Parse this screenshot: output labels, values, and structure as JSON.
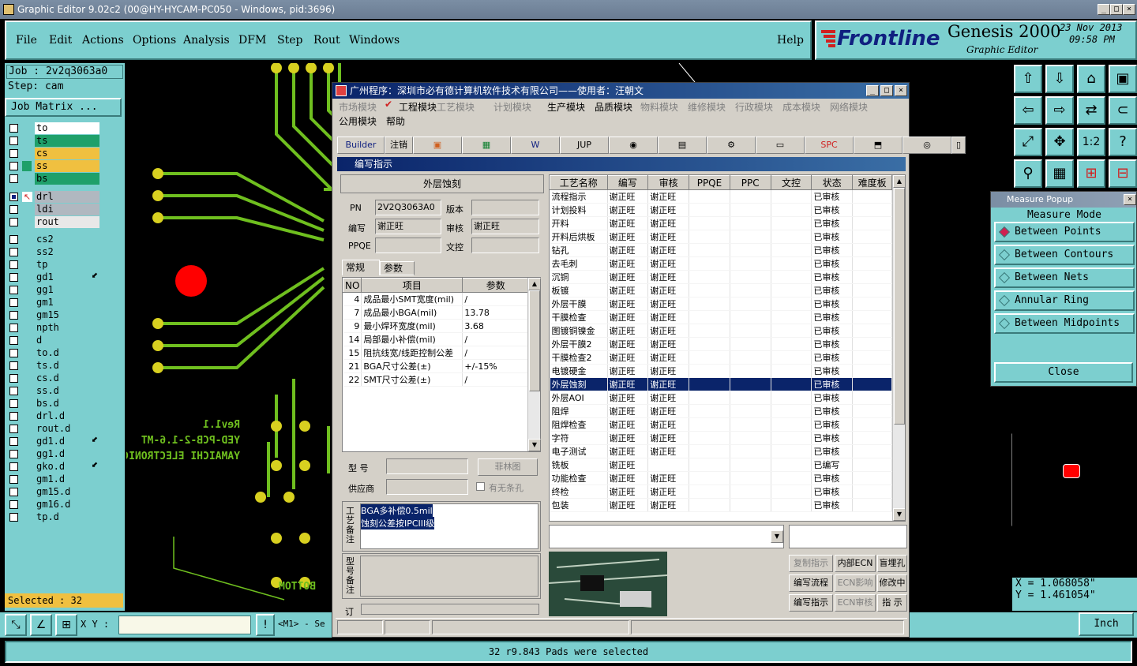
{
  "app": {
    "title": "Graphic Editor 9.02c2 (00@HY-HYCAM-PC050 - Windows, pid:3696)",
    "menus": [
      "File",
      "Edit",
      "Actions",
      "Options",
      "Analysis",
      "DFM",
      "Step",
      "Rout",
      "Windows"
    ],
    "help": "Help",
    "brand_logo": "Frontline",
    "product": "Genesis 2000",
    "subtitle": "Graphic Editor",
    "date": "23 Nov 2013",
    "time": "09:58 PM"
  },
  "left": {
    "job": "Job : 2v2q3063a0",
    "step": "Step: cam",
    "job_matrix": "Job Matrix ...",
    "layers": [
      {
        "name": "to",
        "color": "#ffffff"
      },
      {
        "name": "ts",
        "color": "#1fa06a"
      },
      {
        "name": "cs",
        "color": "#f0c040"
      },
      {
        "name": "ss",
        "color": "#f0c040"
      },
      {
        "name": "bs",
        "color": "#1fa06a"
      },
      {
        "name": "drl",
        "color": "#b0b8c0"
      },
      {
        "name": "ldi",
        "color": "#b0b8c0"
      },
      {
        "name": "rout",
        "color": "#e8e8e8"
      },
      {
        "name": "cs2",
        "color": "#7ccfcf"
      },
      {
        "name": "ss2",
        "color": "#7ccfcf"
      },
      {
        "name": "tp",
        "color": "#7ccfcf"
      },
      {
        "name": "gd1",
        "color": "#7ccfcf"
      },
      {
        "name": "gg1",
        "color": "#7ccfcf"
      },
      {
        "name": "gm1",
        "color": "#7ccfcf"
      },
      {
        "name": "gm15",
        "color": "#7ccfcf"
      },
      {
        "name": "npth",
        "color": "#7ccfcf"
      },
      {
        "name": "d",
        "color": "#7ccfcf"
      },
      {
        "name": "to.d",
        "color": "#7ccfcf"
      },
      {
        "name": "ts.d",
        "color": "#7ccfcf"
      },
      {
        "name": "cs.d",
        "color": "#7ccfcf"
      },
      {
        "name": "ss.d",
        "color": "#7ccfcf"
      },
      {
        "name": "bs.d",
        "color": "#7ccfcf"
      },
      {
        "name": "drl.d",
        "color": "#7ccfcf"
      },
      {
        "name": "rout.d",
        "color": "#7ccfcf"
      },
      {
        "name": "gd1.d",
        "color": "#7ccfcf"
      },
      {
        "name": "gg1.d",
        "color": "#7ccfcf"
      },
      {
        "name": "gko.d",
        "color": "#7ccfcf"
      },
      {
        "name": "gm1.d",
        "color": "#7ccfcf"
      },
      {
        "name": "gm15.d",
        "color": "#7ccfcf"
      },
      {
        "name": "gm16.d",
        "color": "#7ccfcf"
      },
      {
        "name": "tp.d",
        "color": "#7ccfcf"
      }
    ],
    "selected": "Selected : 32"
  },
  "canvas": {
    "silk_lines": [
      "Rev1.1",
      "YED-PCB-2-1.6-MT",
      "YAMAICHI ELECTRONIC"
    ],
    "bottom_label": "BOTTOM"
  },
  "bottom": {
    "xy_label": "X Y :",
    "xy_value": "",
    "mode_text": "<M1> - Se",
    "units": "Inch",
    "status": "32 r9.843 Pads were selected"
  },
  "measure": {
    "title": "Measure Popup",
    "heading": "Measure Mode",
    "options": [
      "Between Points",
      "Between Contours",
      "Between Nets",
      "Annular Ring",
      "Between Midpoints"
    ],
    "close": "Close",
    "x": "X = 1.068058\"",
    "y": "Y = 1.461054\""
  },
  "dialog": {
    "title": "广州程序：深圳市必有德计算机软件技术有限公司——使用者：汪朝文",
    "menu_row1": [
      "市场模块",
      "工程模块",
      "工艺模块",
      "计划模块",
      "生产模块",
      "品质模块",
      "物料模块",
      "维修模块",
      "行政模块",
      "成本模块",
      "网络模块"
    ],
    "menu_row2": [
      "公用模块",
      "帮助"
    ],
    "toolbar": [
      "Builder",
      "注销",
      "",
      "",
      "",
      "JUP",
      "",
      "",
      "",
      "",
      "SPC",
      "",
      "",
      ""
    ],
    "subhead": "编写指示",
    "section_title": "外层蚀刻",
    "pn_label": "PN",
    "pn_value": "2V2Q3063A0",
    "version_label": "版本",
    "version_value": "",
    "writer_label": "编写",
    "writer_value": "谢正旺",
    "reviewer_label": "审核",
    "reviewer_value": "谢正旺",
    "ppqe_label": "PPQE",
    "ppqe_value": "",
    "doc_label": "文控",
    "doc_value": "",
    "tabs": [
      "常规",
      "参数"
    ],
    "param_headers": [
      "NO",
      "项目",
      "参数"
    ],
    "params": [
      {
        "no": "4",
        "item": "成品最小SMT宽度(mil)",
        "val": "/"
      },
      {
        "no": "7",
        "item": "成品最小BGA(mil)",
        "val": "13.78"
      },
      {
        "no": "9",
        "item": "最小焊环宽度(mil)",
        "val": "3.68"
      },
      {
        "no": "14",
        "item": "局部最小补偿(mil)",
        "val": "/"
      },
      {
        "no": "15",
        "item": "阻抗线宽/线距控制公差",
        "val": "/"
      },
      {
        "no": "21",
        "item": "BGA尺寸公差(±)",
        "val": "+/-15%"
      },
      {
        "no": "22",
        "item": "SMT尺寸公差(±)",
        "val": "/"
      }
    ],
    "model_label": "型  号",
    "model_value": "",
    "film_btn": "菲林图",
    "vendor_label": "供应商",
    "vendor_value": "",
    "barcode_label": "有无条孔",
    "process_note_label": "工艺备注",
    "process_note_lines": [
      "BGA多补偿0.5mil",
      "蚀刻公差按IPCIII级"
    ],
    "model_note_label": "型号备注",
    "order_label": "订",
    "proc_headers": [
      "工艺名称",
      "编写",
      "审核",
      "PPQE",
      "PPC",
      "文控",
      "状态",
      "难度板"
    ],
    "processes": [
      {
        "name": "流程指示",
        "w": "谢正旺",
        "r": "谢正旺",
        "s": "已审核"
      },
      {
        "name": "计划投料",
        "w": "谢正旺",
        "r": "谢正旺",
        "s": "已审核"
      },
      {
        "name": "开料",
        "w": "谢正旺",
        "r": "谢正旺",
        "s": "已审核"
      },
      {
        "name": "开料后烘板",
        "w": "谢正旺",
        "r": "谢正旺",
        "s": "已审核"
      },
      {
        "name": "钻孔",
        "w": "谢正旺",
        "r": "谢正旺",
        "s": "已审核"
      },
      {
        "name": "去毛刺",
        "w": "谢正旺",
        "r": "谢正旺",
        "s": "已审核"
      },
      {
        "name": "沉铜",
        "w": "谢正旺",
        "r": "谢正旺",
        "s": "已审核"
      },
      {
        "name": "板镀",
        "w": "谢正旺",
        "r": "谢正旺",
        "s": "已审核"
      },
      {
        "name": "外层干膜",
        "w": "谢正旺",
        "r": "谢正旺",
        "s": "已审核"
      },
      {
        "name": "干膜检查",
        "w": "谢正旺",
        "r": "谢正旺",
        "s": "已审核"
      },
      {
        "name": "图镀铜镍金",
        "w": "谢正旺",
        "r": "谢正旺",
        "s": "已审核"
      },
      {
        "name": "外层干膜2",
        "w": "谢正旺",
        "r": "谢正旺",
        "s": "已审核"
      },
      {
        "name": "干膜检查2",
        "w": "谢正旺",
        "r": "谢正旺",
        "s": "已审核"
      },
      {
        "name": "电镀硬金",
        "w": "谢正旺",
        "r": "谢正旺",
        "s": "已审核"
      },
      {
        "name": "外层蚀刻",
        "w": "谢正旺",
        "r": "谢正旺",
        "s": "已审核"
      },
      {
        "name": "外层AOI",
        "w": "谢正旺",
        "r": "谢正旺",
        "s": "已审核"
      },
      {
        "name": "阻焊",
        "w": "谢正旺",
        "r": "谢正旺",
        "s": "已审核"
      },
      {
        "name": "阻焊检查",
        "w": "谢正旺",
        "r": "谢正旺",
        "s": "已审核"
      },
      {
        "name": "字符",
        "w": "谢正旺",
        "r": "谢正旺",
        "s": "已审核"
      },
      {
        "name": "电子测试",
        "w": "谢正旺",
        "r": "谢正旺",
        "s": "已审核"
      },
      {
        "name": "铣板",
        "w": "谢正旺",
        "r": "",
        "s": "已编写"
      },
      {
        "name": "功能检查",
        "w": "谢正旺",
        "r": "谢正旺",
        "s": "已审核"
      },
      {
        "name": "终检",
        "w": "谢正旺",
        "r": "谢正旺",
        "s": "已审核"
      },
      {
        "name": "包装",
        "w": "谢正旺",
        "r": "谢正旺",
        "s": "已审核"
      }
    ],
    "side_buttons": [
      "复制指示",
      "内部ECN",
      "盲埋孔",
      "编写流程",
      "ECN影响",
      "修改中",
      "编写指示",
      "ECN审核",
      "指 示"
    ]
  },
  "colors": {
    "teal": "#7ccfcf",
    "trace": "#6fbf1f",
    "pad": "#d8d020",
    "selection": "#0a246a",
    "red_pad": "#ff0000"
  }
}
